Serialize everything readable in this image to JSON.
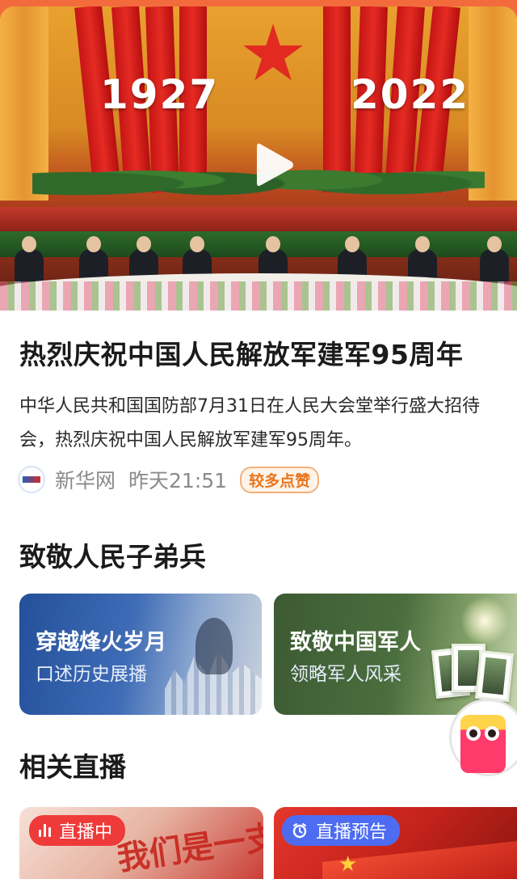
{
  "hero": {
    "year_left": "1927",
    "year_right": "2022"
  },
  "article": {
    "title": "热烈庆祝中国人民解放军建军95周年",
    "summary": "中华人民共和国国防部7月31日在人民大会堂举行盛大招待会，热烈庆祝中国人民解放军建军95周年。",
    "source": "新华网",
    "time": "昨天21:51",
    "badge": "较多点赞"
  },
  "section_salute": {
    "heading": "致敬人民子弟兵",
    "tiles": [
      {
        "title": "穿越烽火岁月",
        "subtitle": "口述历史展播"
      },
      {
        "title": "致敬中国军人",
        "subtitle": "领略军人风采"
      }
    ]
  },
  "section_live": {
    "heading": "相关直播",
    "cards": [
      {
        "badge": "直播中",
        "deco": "我们是一支"
      },
      {
        "badge": "直播预告"
      }
    ]
  },
  "colors": {
    "accent_orange": "#f36b3d",
    "badge_live_red": "#ef3a3a",
    "badge_preview_blue": "#4d6cf2",
    "badge_like_orange": "#e8761f"
  },
  "icons": [
    "play-icon",
    "xinhua-logo",
    "live-bars-icon",
    "alarm-clock-icon",
    "mascot-icon"
  ]
}
